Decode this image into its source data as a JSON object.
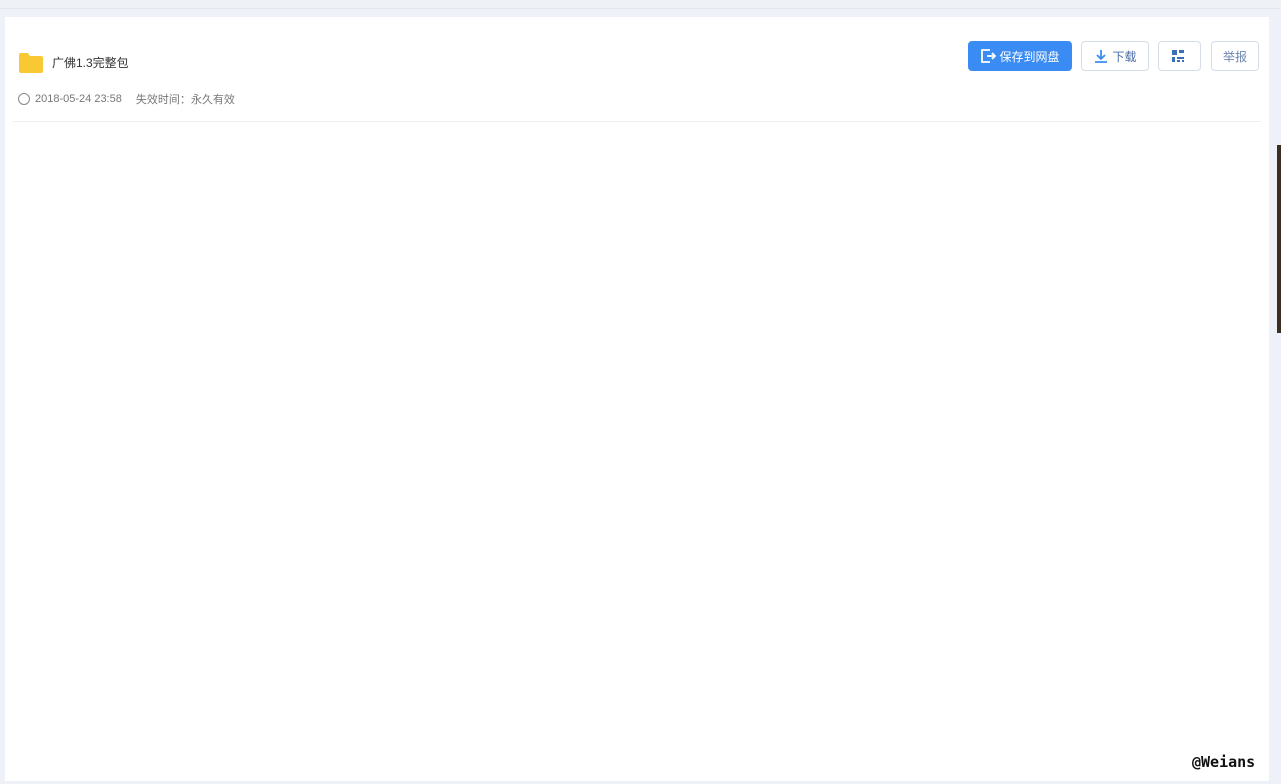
{
  "file": {
    "name": "广佛1.3完整包",
    "date": "2018-05-24 23:58",
    "expire": "失效时间：永久有效"
  },
  "actions": {
    "save": "保存到网盘",
    "download": "下载",
    "report": "举报"
  },
  "watermark": "@Weians",
  "colors": {
    "primary": "#3a8cf4",
    "folder": "#f9c934"
  }
}
